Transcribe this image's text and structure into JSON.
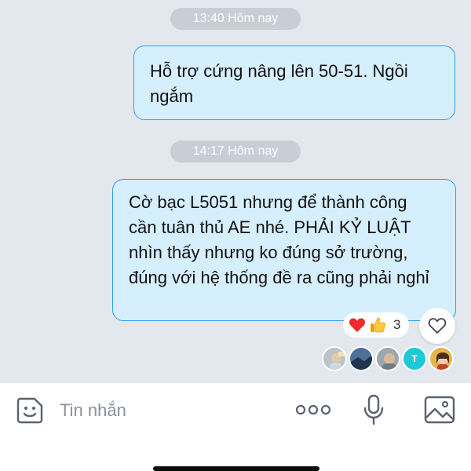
{
  "conversation": {
    "messages": [
      {
        "time": "13:40 Hôm nay",
        "text": "Hỗ trợ cứng nâng lên 50-51. Ngồi ngắm"
      },
      {
        "time": "14:17 Hôm nay",
        "text": "Cờ bạc L5051 nhưng để thành công cần tuân thủ AE nhé. PHẢI KỶ LUẬT nhìn thấy nhưng ko đúng sở trường, đúng với hệ thống đề ra cũng phải nghỉ"
      }
    ],
    "reactions": {
      "icons": [
        "heart-emoji",
        "thumbs-up-emoji"
      ],
      "count": "3"
    },
    "seen_by": [
      "avatar-1",
      "avatar-2",
      "avatar-3",
      "T",
      "avatar-5"
    ]
  },
  "composer": {
    "placeholder": "Tin nhắn",
    "icons": [
      "sticker-icon",
      "more-icon",
      "microphone-icon",
      "image-icon"
    ]
  },
  "colors": {
    "chat_bg": "#e3e8ef",
    "bubble_bg": "#d6efff",
    "bubble_border": "#2f9fe6",
    "time_pill": "#c9ced6"
  }
}
